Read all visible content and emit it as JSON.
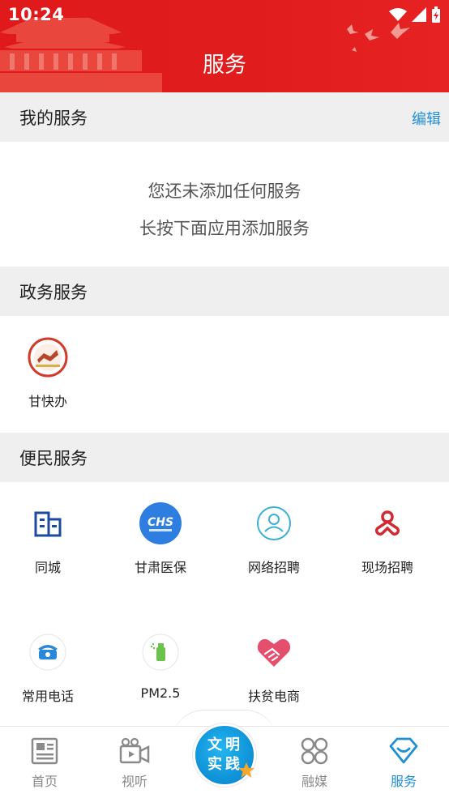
{
  "status_bar": {
    "time": "10:24"
  },
  "header": {
    "title": "服务"
  },
  "my_services": {
    "title": "我的服务",
    "edit_label": "编辑",
    "empty_line1": "您还未添加任何服务",
    "empty_line2": "长按下面应用添加服务"
  },
  "gov_services": {
    "title": "政务服务",
    "items": [
      {
        "label": "甘快办",
        "icon": "gankuaiban-logo-icon"
      }
    ]
  },
  "public_services": {
    "title": "便民服务",
    "items": [
      {
        "label": "同城",
        "icon": "building-icon"
      },
      {
        "label": "甘肃医保",
        "icon": "chs-logo-icon",
        "badge": "CHS"
      },
      {
        "label": "网络招聘",
        "icon": "user-circle-icon"
      },
      {
        "label": "现场招聘",
        "icon": "knot-icon"
      },
      {
        "label": "常用电话",
        "icon": "telephone-icon"
      },
      {
        "label": "PM2.5",
        "icon": "spray-icon"
      },
      {
        "label": "扶贫电商",
        "icon": "heart-handshake-icon"
      }
    ]
  },
  "bottom_nav": {
    "items": [
      {
        "label": "首页",
        "icon": "newspaper-icon"
      },
      {
        "label": "视听",
        "icon": "video-camera-icon"
      },
      {
        "label": "融媒",
        "icon": "grid-icon"
      },
      {
        "label": "服务",
        "icon": "heart-diamond-icon",
        "active": true
      }
    ],
    "center": {
      "line1": "文明",
      "line2": "实践"
    }
  },
  "colors": {
    "header_red": "#e01a1a",
    "accent_blue": "#1f8fd6",
    "section_gray": "#efefef"
  }
}
